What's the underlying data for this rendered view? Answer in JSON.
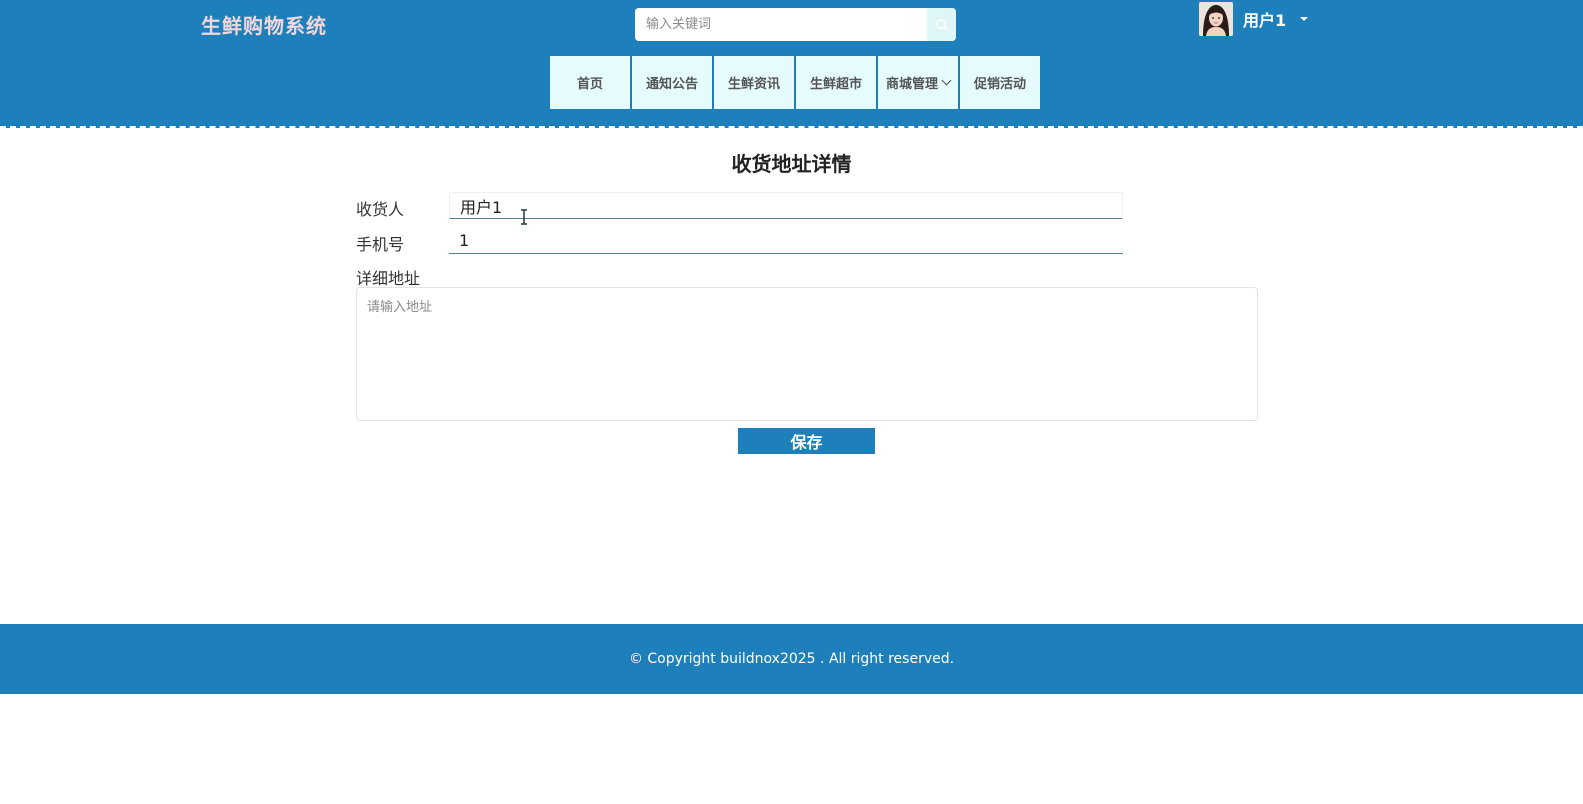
{
  "header": {
    "brand": "生鲜购物系统",
    "search": {
      "placeholder": "输入关键词",
      "value": ""
    },
    "user": {
      "name": "用户1"
    }
  },
  "nav": {
    "items": [
      {
        "label": "首页"
      },
      {
        "label": "通知公告"
      },
      {
        "label": "生鲜资讯"
      },
      {
        "label": "生鲜超市"
      },
      {
        "label": "商城管理"
      },
      {
        "label": "促销活动"
      }
    ]
  },
  "form": {
    "title": "收货地址详情",
    "consignee": {
      "label": "收货人",
      "value": "用户1"
    },
    "phone": {
      "label": "手机号",
      "value": "1"
    },
    "address": {
      "label": "详细地址",
      "placeholder": "请输入地址",
      "value": ""
    },
    "save_label": "保存"
  },
  "footer": {
    "copyright": "© Copyright buildnox2025 . All right reserved."
  },
  "colors": {
    "primary": "#1e80bb",
    "nav_bg": "#e6fbfd",
    "brand_text": "#f2d6dd"
  }
}
